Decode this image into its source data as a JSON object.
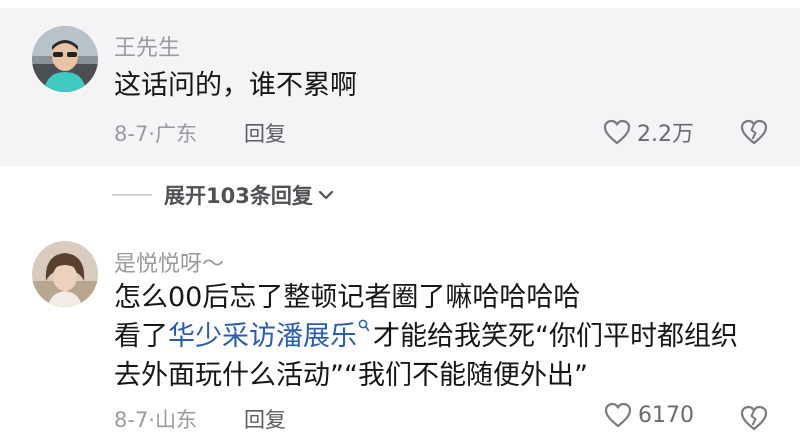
{
  "comments": [
    {
      "username": "王先生",
      "lines": [
        "这话问的，谁不累啊"
      ],
      "date_location": "8-7·广东",
      "reply_label": "回复",
      "likes": "2.2万"
    },
    {
      "username": "是悦悦呀～",
      "lines": [
        "怎么00后忘了整顿记者圈了嘛哈哈哈哈"
      ],
      "line2_prefix": "看了",
      "mention": "华少采访潘展乐",
      "line2_suffix": "才能给我笑死“你们平时都组织",
      "line3": "去外面玩什么活动”“我们不能随便外出”",
      "date_location": "8-7·山东",
      "reply_label": "回复",
      "likes": "6170"
    }
  ],
  "expand_replies": "展开103条回复",
  "icons": {
    "like": "heart-outline-icon",
    "dislike": "broken-heart-icon",
    "expand": "chevron-down-icon",
    "mention": "search-icon"
  },
  "colors": {
    "highlight_bg": "#f4f4f6",
    "mention": "#2a5db0",
    "meta": "#9a9a9f"
  }
}
